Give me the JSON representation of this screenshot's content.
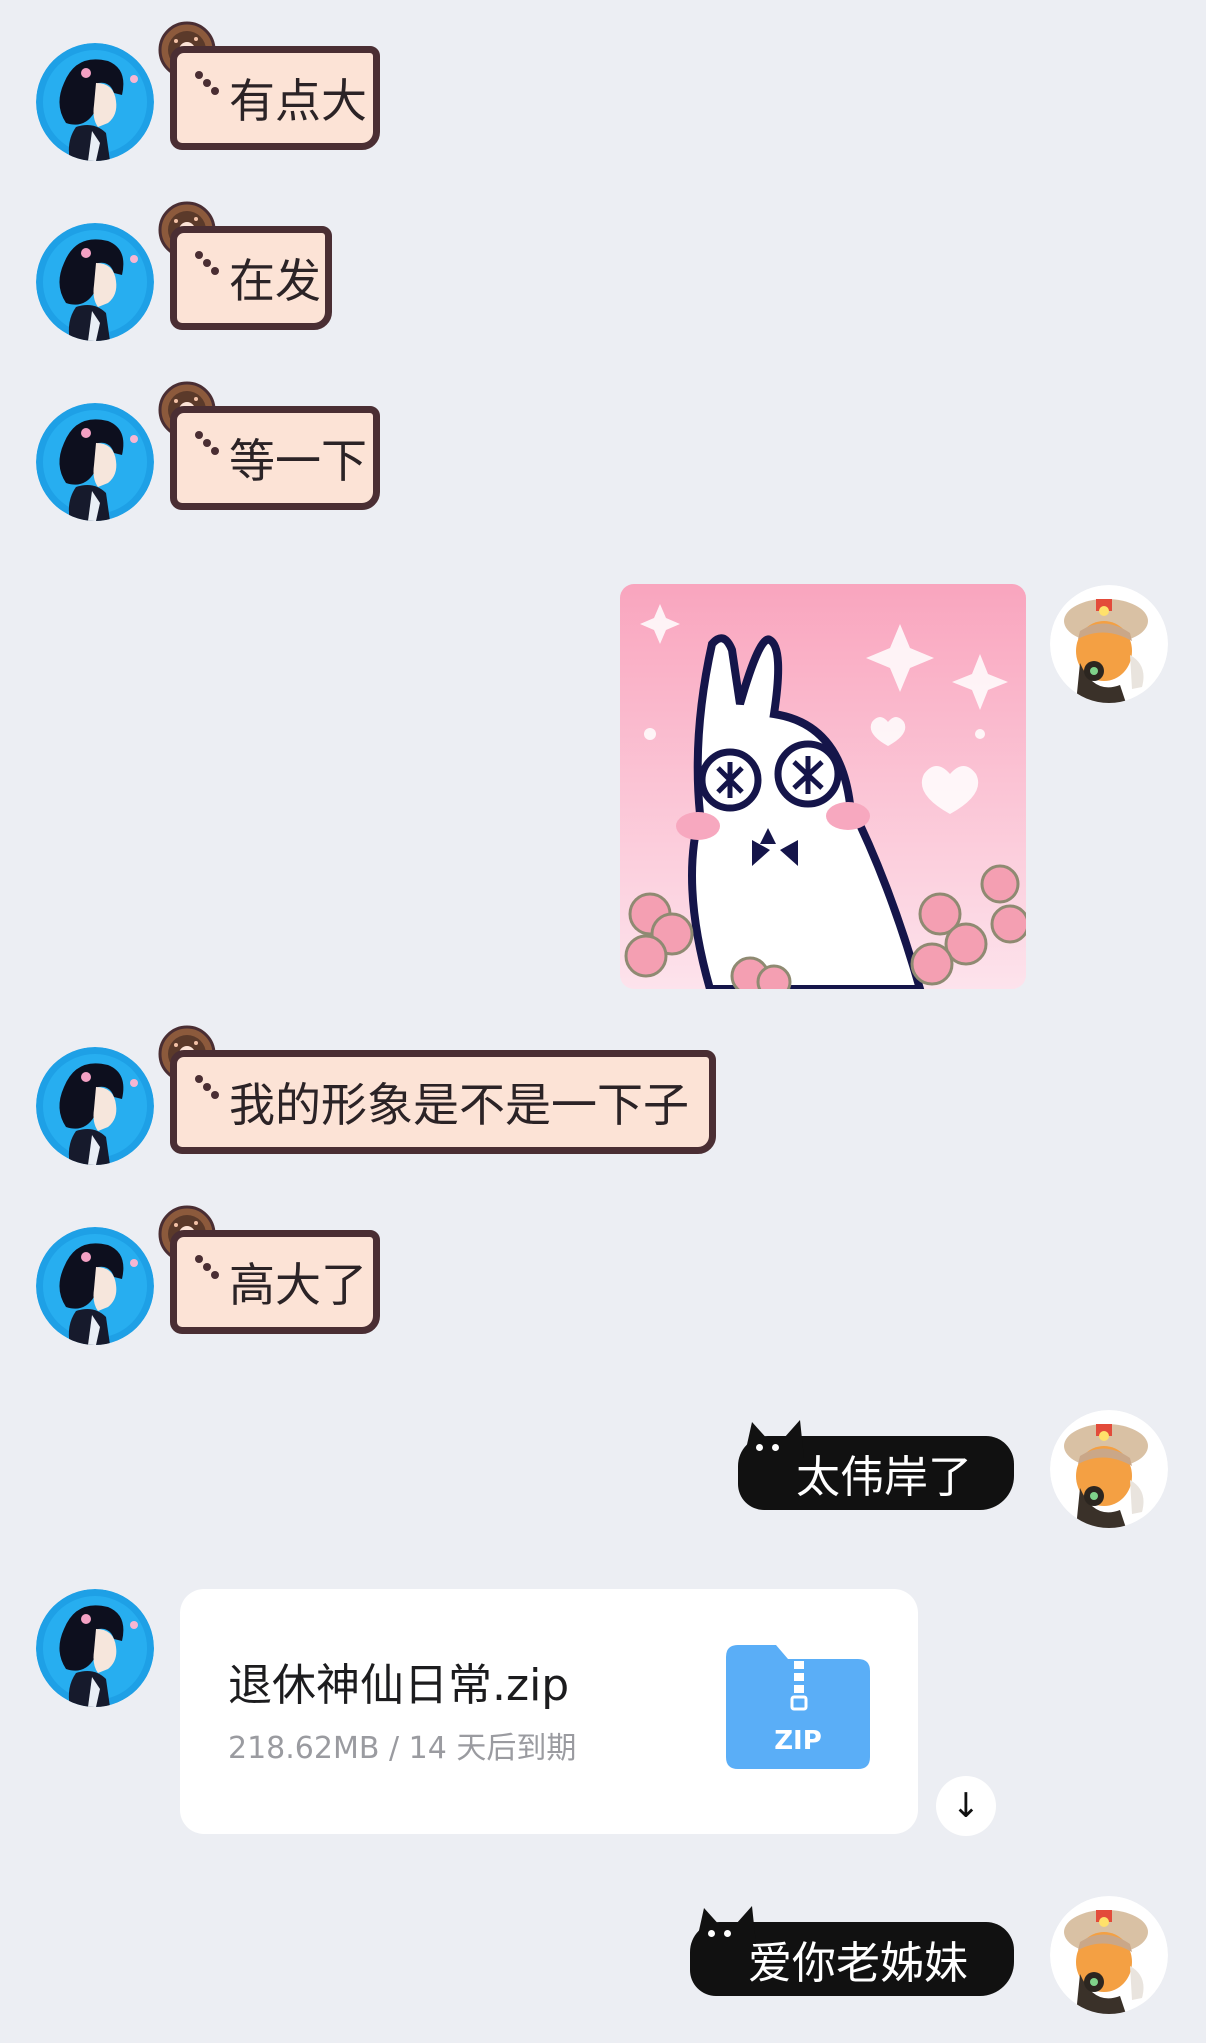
{
  "messages": [
    {
      "text": "有点大"
    },
    {
      "text": "在发"
    },
    {
      "text": "等一下"
    },
    {
      "text": "我的形象是不是一下子"
    },
    {
      "text": "高大了"
    },
    {
      "text": "太伟岸了"
    },
    {
      "text": "爱你老姊妹"
    }
  ],
  "file": {
    "name": "退休神仙日常.zip",
    "meta": "218.62MB / 14 天后到期",
    "icon_label": "ZIP",
    "download_icon": "↓"
  },
  "colors": {
    "background": "#eceef3",
    "pink_bubble": "#fce3d6",
    "pink_border": "#4a2e33",
    "black_bubble": "#111111",
    "file_icon": "#5aaef7"
  }
}
